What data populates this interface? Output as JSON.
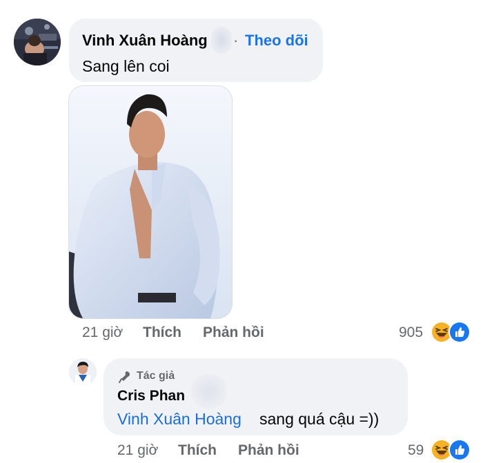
{
  "comment": {
    "author": "Vinh Xuân Hoàng",
    "separator": "·",
    "follow_label": "Theo dõi",
    "text": "Sang lên coi",
    "time": "21 giờ",
    "like_label": "Thích",
    "reply_label": "Phản hồi",
    "reaction_count": "905",
    "reactions": [
      "haha-icon",
      "like-icon"
    ]
  },
  "reply": {
    "badge_label": "Tác giả",
    "author": "Cris Phan",
    "mention": "Vinh Xuân Hoàng",
    "text": "sang quá cậu =))",
    "time": "21 giờ",
    "like_label": "Thích",
    "reply_label": "Phản hồi",
    "reaction_count": "59",
    "reactions": [
      "haha-icon",
      "like-icon"
    ]
  },
  "colors": {
    "bubble": "#f0f2f5",
    "link_blue": "#1b74e4",
    "meta_gray": "#65676b",
    "haha_yellow": "#f7b125",
    "like_blue": "#1877f2"
  }
}
